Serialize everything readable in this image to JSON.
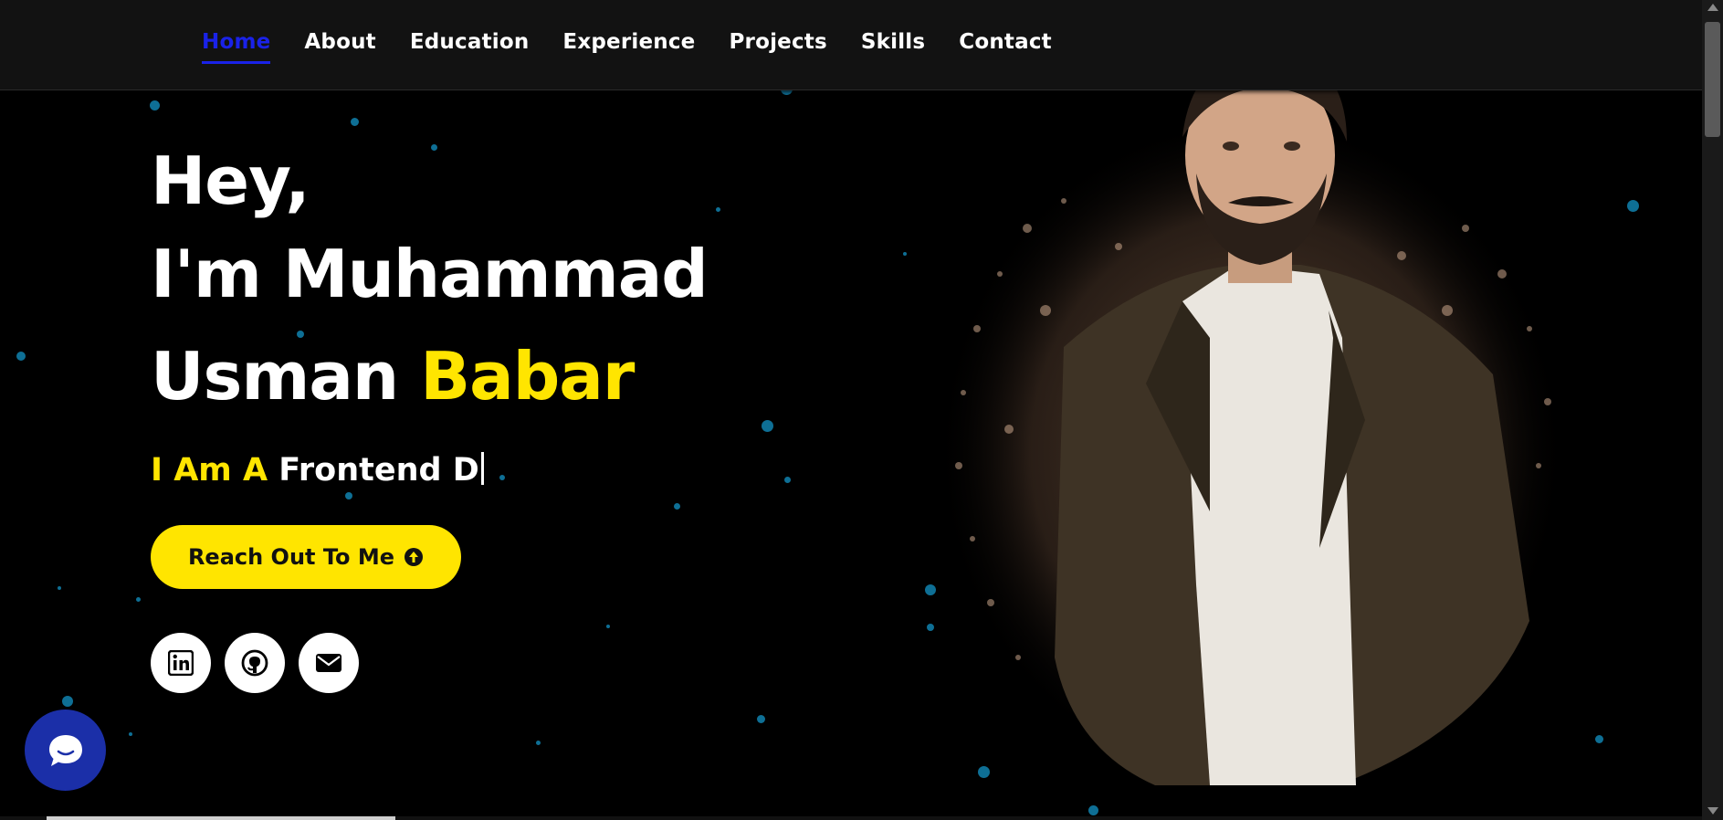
{
  "nav": {
    "items": [
      {
        "label": "Home",
        "active": true
      },
      {
        "label": "About"
      },
      {
        "label": "Education"
      },
      {
        "label": "Experience"
      },
      {
        "label": "Projects"
      },
      {
        "label": "Skills"
      },
      {
        "label": "Contact"
      }
    ]
  },
  "hero": {
    "line1": "Hey,",
    "line2": "I'm Muhammad",
    "line3_name": "Usman",
    "line3_accent": "Babar",
    "typed_prefix": "I Am A",
    "typed_text": "Frontend D",
    "cta_label": "Reach Out To Me",
    "cta_icon": "arrow-up-circle-icon"
  },
  "socials": [
    {
      "icon": "linkedin-icon"
    },
    {
      "icon": "github-icon"
    },
    {
      "icon": "envelope-icon"
    }
  ],
  "chat_widget": {
    "icon": "chat-bubble-icon"
  },
  "colors": {
    "accent": "#ffe500",
    "nav_active": "#1a22e8",
    "background": "#000000",
    "navbar": "#121212",
    "particle": "#0e6f95",
    "chat_widget": "#1b2fa8"
  }
}
